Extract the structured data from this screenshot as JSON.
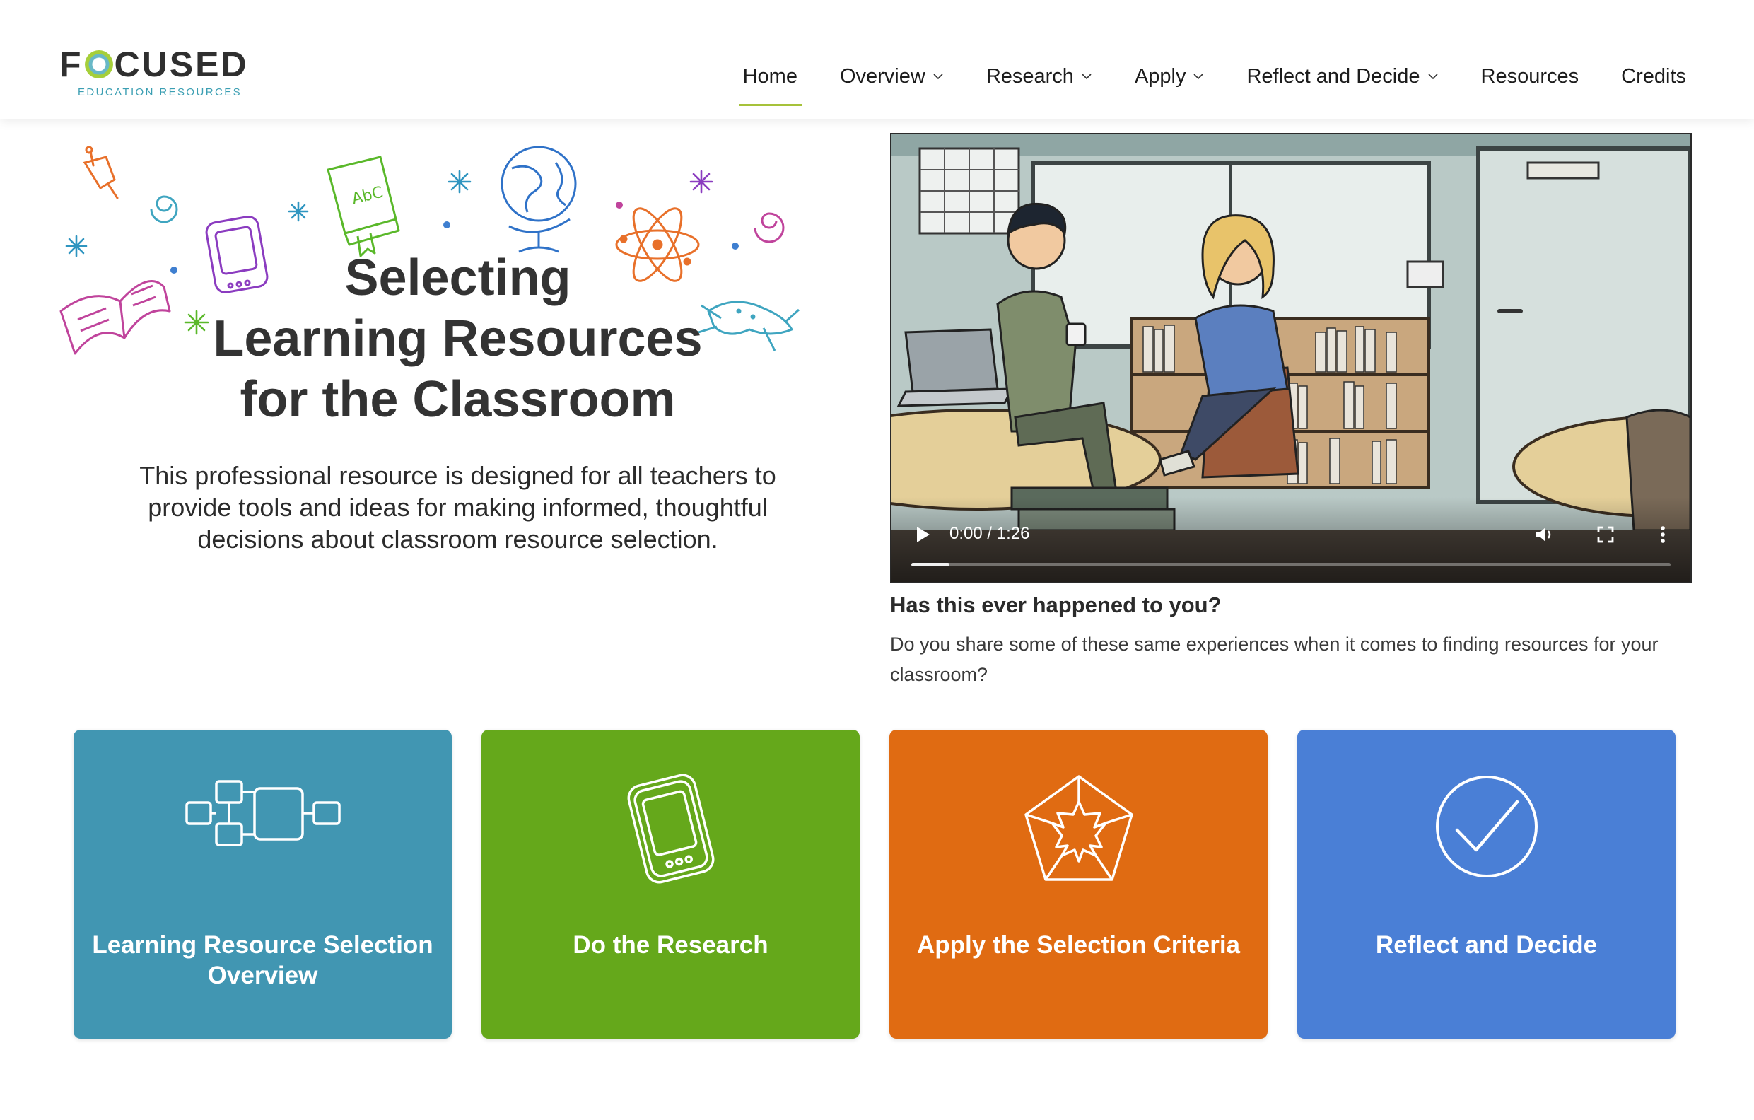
{
  "logo": {
    "wordmark_left": "F",
    "wordmark_right": "CUSED",
    "subtitle": "EDUCATION RESOURCES"
  },
  "nav": {
    "items": [
      {
        "label": "Home",
        "active": true,
        "dropdown": false
      },
      {
        "label": "Overview",
        "active": false,
        "dropdown": true
      },
      {
        "label": "Research",
        "active": false,
        "dropdown": true
      },
      {
        "label": "Apply",
        "active": false,
        "dropdown": true
      },
      {
        "label": "Reflect and Decide",
        "active": false,
        "dropdown": true
      },
      {
        "label": "Resources",
        "active": false,
        "dropdown": false
      },
      {
        "label": "Credits",
        "active": false,
        "dropdown": false
      }
    ],
    "active_color": "#a6c23a"
  },
  "hero": {
    "title_line1": "Selecting",
    "title_line2": "Learning Resources",
    "title_line3": "for the Classroom",
    "description": "This professional resource is designed for all teachers to provide tools and ideas for making informed, thoughtful decisions about classroom resource selection.",
    "doodle_book_text": "AbC"
  },
  "video": {
    "time": "0:00 / 1:26",
    "progress": 0.05,
    "caption_title": "Has this ever happened to you?",
    "caption_text": "Do you share some of these same experiences when it comes to finding resources for your classroom?"
  },
  "cards": [
    {
      "label": "Learning Resource Selection Overview",
      "color": "#4196b2",
      "icon": "flowchart-icon"
    },
    {
      "label": "Do the Research",
      "color": "#65a81b",
      "icon": "tablet-icon"
    },
    {
      "label": "Apply the Selection Criteria",
      "color": "#e06b12",
      "icon": "pentagon-icon"
    },
    {
      "label": "Reflect and Decide",
      "color": "#4a7fd6",
      "icon": "checkmark-circle-icon"
    }
  ]
}
